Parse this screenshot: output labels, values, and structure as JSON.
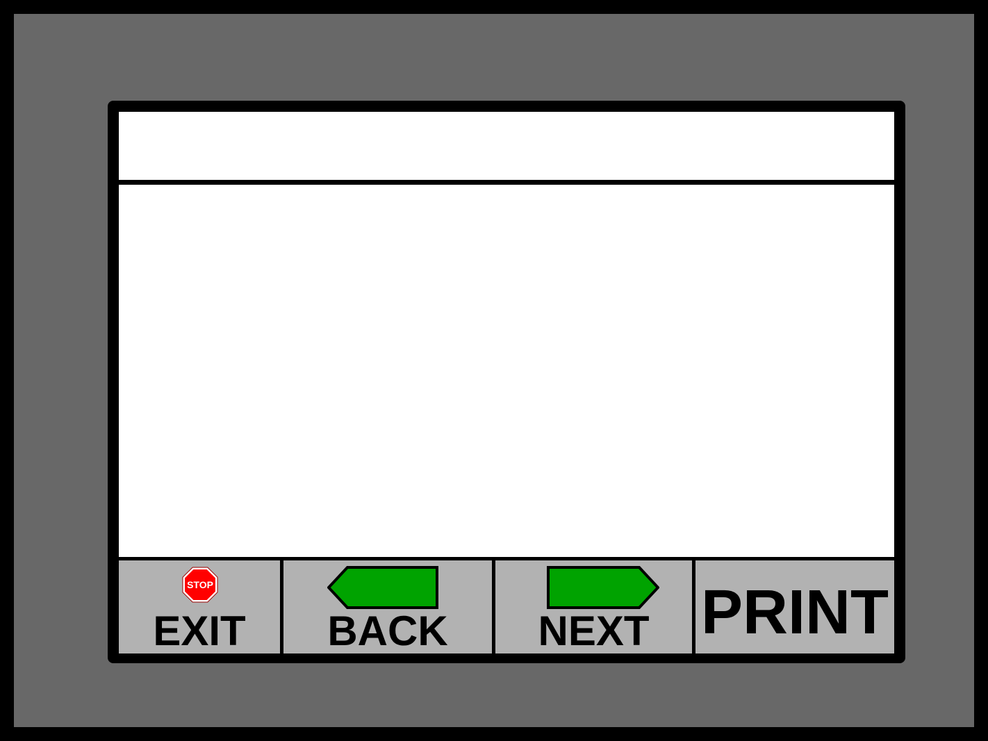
{
  "header": {
    "title": ""
  },
  "buttons": {
    "exit": {
      "label": "EXIT",
      "icon": "stop-sign-icon",
      "icon_text": "STOP",
      "icon_color": "#ff0000"
    },
    "back": {
      "label": "BACK",
      "icon": "left-arrow-icon",
      "icon_color": "#00a300"
    },
    "next": {
      "label": "NEXT",
      "icon": "right-arrow-icon",
      "icon_color": "#00a300"
    },
    "print": {
      "label": "PRINT"
    }
  },
  "colors": {
    "bezel": "#686868",
    "button_face": "#b2b2b2",
    "screen_background": "#ffffff",
    "arrow_green": "#00a300",
    "stop_red": "#ff0000"
  }
}
